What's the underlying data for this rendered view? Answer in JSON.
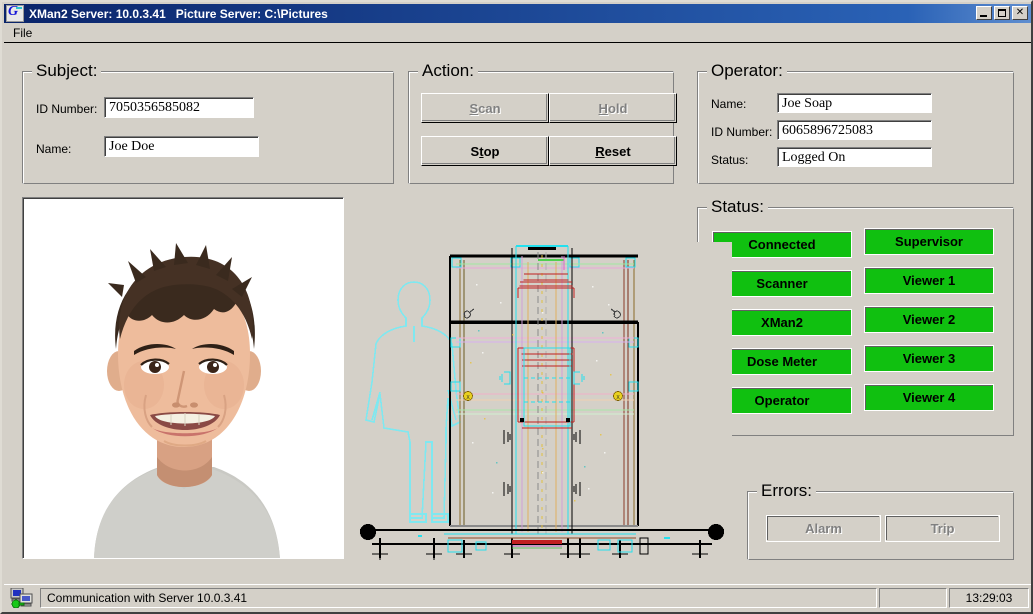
{
  "window": {
    "title": "XMan2 Server: 10.0.3.41   Picture Server: C:\\Pictures",
    "icon": "g-logo-icon",
    "minimize_label": "_",
    "maximize_label": "□",
    "close_label": "×"
  },
  "menu": {
    "items": [
      {
        "label": "File"
      }
    ]
  },
  "subject": {
    "legend": "Subject:",
    "fields": [
      {
        "label": "ID Number:",
        "value": "7050356585082"
      },
      {
        "label": "Name:",
        "value": "Joe Doe"
      }
    ]
  },
  "action": {
    "legend": "Action:",
    "buttons": [
      {
        "label": "Scan",
        "accel": "S",
        "enabled": false
      },
      {
        "label": "Hold",
        "accel": "H",
        "enabled": false
      },
      {
        "label": "Stop",
        "accel": "t",
        "enabled": true
      },
      {
        "label": "Reset",
        "accel": "R",
        "enabled": true
      }
    ]
  },
  "operator": {
    "legend": "Operator:",
    "fields": [
      {
        "label": "Name:",
        "value": "Joe Soap"
      },
      {
        "label": "ID Number:",
        "value": "6065896725083"
      },
      {
        "label": "Status:",
        "value": "Logged On"
      }
    ]
  },
  "status": {
    "legend": "Status:",
    "on_color": "#10c010",
    "left_column": [
      {
        "label": "Connected",
        "state": "on"
      },
      {
        "label": "Scanner",
        "state": "on"
      },
      {
        "label": "XMan2",
        "state": "on"
      },
      {
        "label": "Dose Meter",
        "state": "on"
      },
      {
        "label": "Operator",
        "state": "on"
      }
    ],
    "right_column": [
      {
        "label": "Supervisor",
        "state": "on"
      },
      {
        "label": "Viewer 1",
        "state": "on"
      },
      {
        "label": "Viewer 2",
        "state": "on"
      },
      {
        "label": "Viewer 3",
        "state": "on"
      },
      {
        "label": "Viewer 4",
        "state": "on"
      }
    ]
  },
  "errors": {
    "legend": "Errors:",
    "off_color": "#d4d0c8",
    "indicators": [
      {
        "label": "Alarm",
        "state": "off"
      },
      {
        "label": "Trip",
        "state": "off"
      }
    ]
  },
  "photo": {
    "alt": "subject-portrait-photo"
  },
  "drawing": {
    "alt": "body-scanner-technical-drawing",
    "silhouette_color": "#7fe8f0"
  },
  "statusbar": {
    "icon": "network-computers-icon",
    "message": "Communication with Server 10.0.3.41",
    "middle": "",
    "time": "13:29:03"
  }
}
